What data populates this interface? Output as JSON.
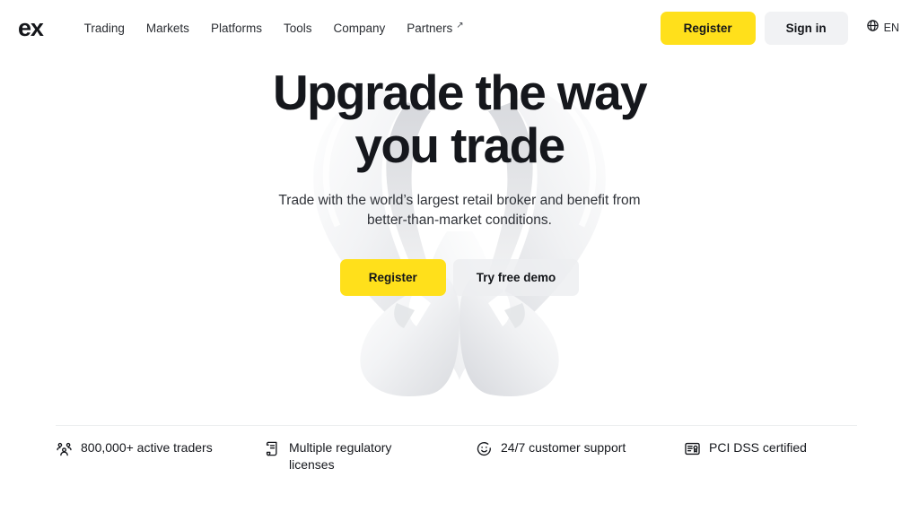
{
  "header": {
    "logo": "ex",
    "nav": [
      {
        "label": "Trading",
        "external": false
      },
      {
        "label": "Markets",
        "external": false
      },
      {
        "label": "Platforms",
        "external": false
      },
      {
        "label": "Tools",
        "external": false
      },
      {
        "label": "Company",
        "external": false
      },
      {
        "label": "Partners",
        "external": true,
        "arrow": "↗"
      }
    ],
    "register_label": "Register",
    "signin_label": "Sign in",
    "language": "EN",
    "language_icon": "globe-icon"
  },
  "hero": {
    "title_line1": "Upgrade the way",
    "title_line2": "you trade",
    "subtitle": "Trade with the world’s largest retail broker and benefit from better-than-market conditions.",
    "register_label": "Register",
    "demo_label": "Try free demo"
  },
  "features": [
    {
      "icon": "users-group-icon",
      "label": "800,000+ active traders"
    },
    {
      "icon": "document-scroll-icon",
      "label": "Multiple regulatory licenses"
    },
    {
      "icon": "smiley-face-icon",
      "label": "24/7 customer support"
    },
    {
      "icon": "certificate-badge-icon",
      "label": "PCI DSS certified"
    }
  ],
  "colors": {
    "brand_yellow": "#FFE01B",
    "text_dark": "#15171c",
    "surface_gray": "#F1F2F4",
    "divider": "#eceef0",
    "background": "#ffffff"
  }
}
